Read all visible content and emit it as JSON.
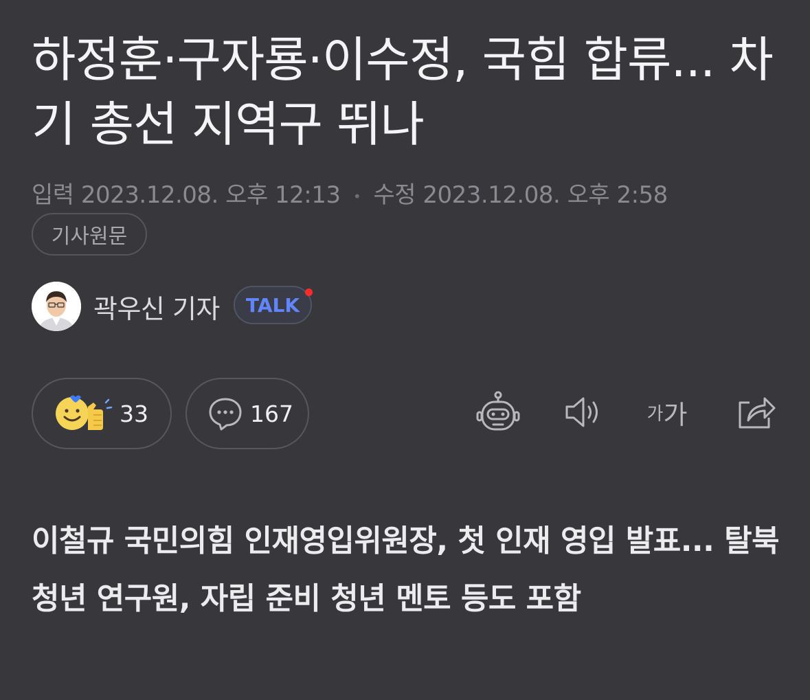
{
  "article": {
    "title": "하정훈·구자룡·이수정, 국힘 합류... 차기 총선 지역구 뛰나",
    "input_label": "입력",
    "input_time": "2023.12.08. 오후 12:13",
    "modified_label": "수정",
    "modified_time": "2023.12.08. 오후 2:58",
    "original_button": "기사원문",
    "lead": "이철규 국민의힘 인재영입위원장, 첫 인재 영입 발표... 탈북 청년 연구원, 자립 준비 청년 멘토 등도 포함"
  },
  "reporter": {
    "name": "곽우신 기자",
    "talk_label": "TALK"
  },
  "reactions": {
    "like_count": "33",
    "comment_count": "167"
  },
  "tools": {
    "robot_icon": "summary-bot-icon",
    "speaker_icon": "speaker-icon",
    "font_small": "가",
    "font_large": "가",
    "share_icon": "share-icon"
  },
  "colors": {
    "background": "#37373c",
    "talk_blue": "#5f86ff",
    "notification_red": "#ff2b2b"
  }
}
